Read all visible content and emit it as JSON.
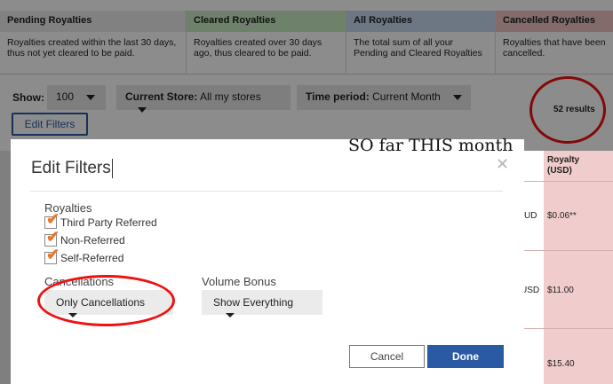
{
  "legend": [
    {
      "title": "Pending Royalties",
      "desc": "Royalties created within the last 30 days, thus not yet cleared to be paid.",
      "color": "#ececec"
    },
    {
      "title": "Cleared Royalties",
      "desc": "Royalties created over 30 days ago, thus cleared to be paid.",
      "color": "#c9ebc4"
    },
    {
      "title": "All Royalties",
      "desc": "The total sum of all your Pending and Cleared Royalties",
      "color": "#c6d9ef"
    },
    {
      "title": "Cancelled Royalties",
      "desc": "Royalties that have been cancelled.",
      "color": "#efc4c4"
    }
  ],
  "filters": {
    "show_label": "Show:",
    "show_value": "100",
    "store_label": "Current Store:",
    "store_value": "All my stores",
    "period_label": "Time period:",
    "period_value": "Current Month",
    "edit_button": "Edit Filters",
    "results": "52 results"
  },
  "table": {
    "royalty_header_line1": "Royalty",
    "royalty_header_line2": "(USD)",
    "rows": [
      {
        "currency": "UD",
        "royalty": "$0.06**"
      },
      {
        "currency": "USD",
        "royalty": "$11.00"
      },
      {
        "currency": "",
        "royalty": "$15.40"
      }
    ]
  },
  "modal": {
    "title": "Edit Filters",
    "close_glyph": "✕",
    "annotation": "SO far THIS month",
    "royalties_label": "Royalties",
    "checkboxes": [
      {
        "label": "Third Party Referred",
        "checked": true
      },
      {
        "label": "Non-Referred",
        "checked": true
      },
      {
        "label": "Self-Referred",
        "checked": true
      }
    ],
    "cancellations_label": "Cancellations",
    "cancellations_value": "Only Cancellations",
    "volume_label": "Volume Bonus",
    "volume_value": "Show Everything",
    "cancel_button": "Cancel",
    "done_button": "Done"
  },
  "colors": {
    "accent": "#2a5aa4",
    "annotation_circle": "#ee1111",
    "check": "#e8772a"
  }
}
